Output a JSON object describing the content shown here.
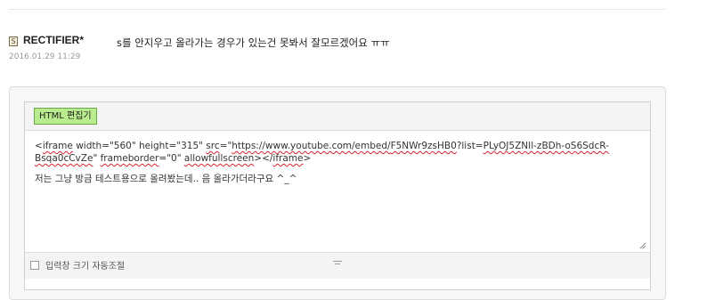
{
  "comment": {
    "level_icon": "S",
    "nickname": "RECTIFIER*",
    "timestamp": "2016.01.29 11:29",
    "text": "s를 안지우고 올라가는 경우가 있는건 못봐서 잘모르겠어요  ㅠㅠ"
  },
  "editor": {
    "html_button_label": "HTML 편집기",
    "line1": {
      "a": "<",
      "b": "iframe",
      "c": " width=\"560\" height=\"315\" ",
      "d": "src",
      "e": "=\"",
      "f": "https://www.youtube.com/embed/",
      "g": "F5NWr9zsHB0",
      "h": "?list=",
      "i": "PLyOJ5ZNIl-zBDh-oS6SdcR-"
    },
    "line2": {
      "a": "Bsqa0cCvZe",
      "b": "\" ",
      "c": "frameborder",
      "d": "=\"0\" ",
      "e": "allowfullscreen",
      "f": "></",
      "g": "iframe",
      "h": ">"
    },
    "message": "저는 그냥 방금 테스트용으로 올려봤는데.. 음 올라가더라구요 ^_^",
    "autosize_label": "입력창 크기 자동조절",
    "autosize_checked": false
  },
  "icons": {
    "level": "level-badge-icon",
    "grip": "resize-grip-icon",
    "drag": "drag-handle-icon"
  },
  "colors": {
    "html_button_bg": "#b8ec8c",
    "spellcheck_underline": "#dd2233"
  }
}
